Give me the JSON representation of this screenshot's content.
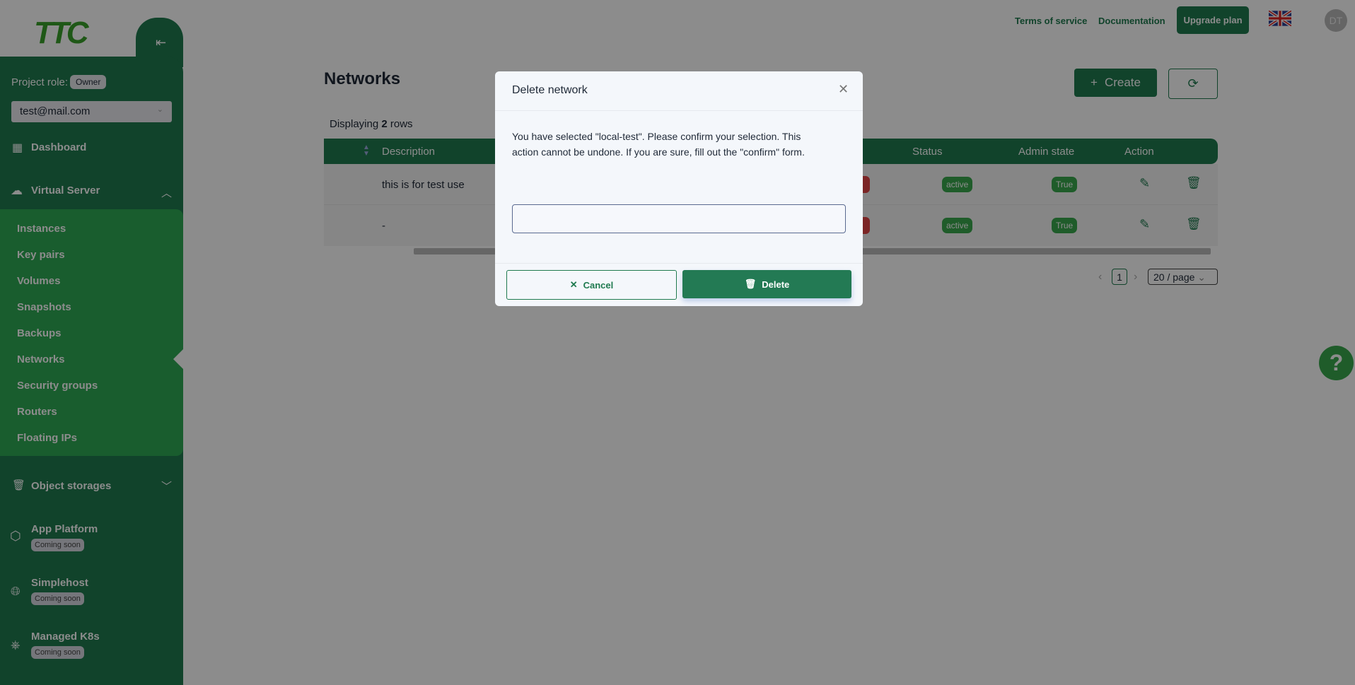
{
  "header": {
    "terms": "Terms of service",
    "docs": "Documentation",
    "upgrade": "Upgrade plan",
    "avatar": "DT",
    "language": "en-GB"
  },
  "sidebar": {
    "logo": "TTC",
    "project_role_label": "Project role:",
    "project_role": "Owner",
    "account": "test@mail.com",
    "dashboard": "Dashboard",
    "virtual_server": "Virtual Server",
    "sub_items": [
      "Instances",
      "Key pairs",
      "Volumes",
      "Snapshots",
      "Backups",
      "Networks",
      "Security groups",
      "Routers",
      "Floating IPs"
    ],
    "object_storages": "Object storages",
    "app_platform": "App Platform",
    "simplehost": "Simplehost",
    "k8s": "Managed K8s",
    "coming_soon": "Coming soon"
  },
  "main": {
    "title": "Networks",
    "create": "Create",
    "displaying_prefix": "Displaying",
    "row_count": "2",
    "displaying_suffix": "rows",
    "columns": {
      "description": "Description",
      "status": "Status",
      "admin_state": "Admin state",
      "action": "Action"
    },
    "rows": [
      {
        "description": "this is for test use",
        "status": "active",
        "admin_state": "True"
      },
      {
        "description": "-",
        "status": "active",
        "admin_state": "True"
      }
    ],
    "page": "1",
    "page_size": "20 / page"
  },
  "modal": {
    "title": "Delete network",
    "line1": "You have selected \"local-test\". Please confirm your selection. This",
    "line2": "action cannot be undone. If you are sure, fill out the \"confirm\" form.",
    "input_value": "",
    "cancel": "Cancel",
    "delete": "Delete"
  },
  "colors": {
    "primary": "#1f7a4f",
    "accent": "#2fa954",
    "danger": "#e04444"
  }
}
